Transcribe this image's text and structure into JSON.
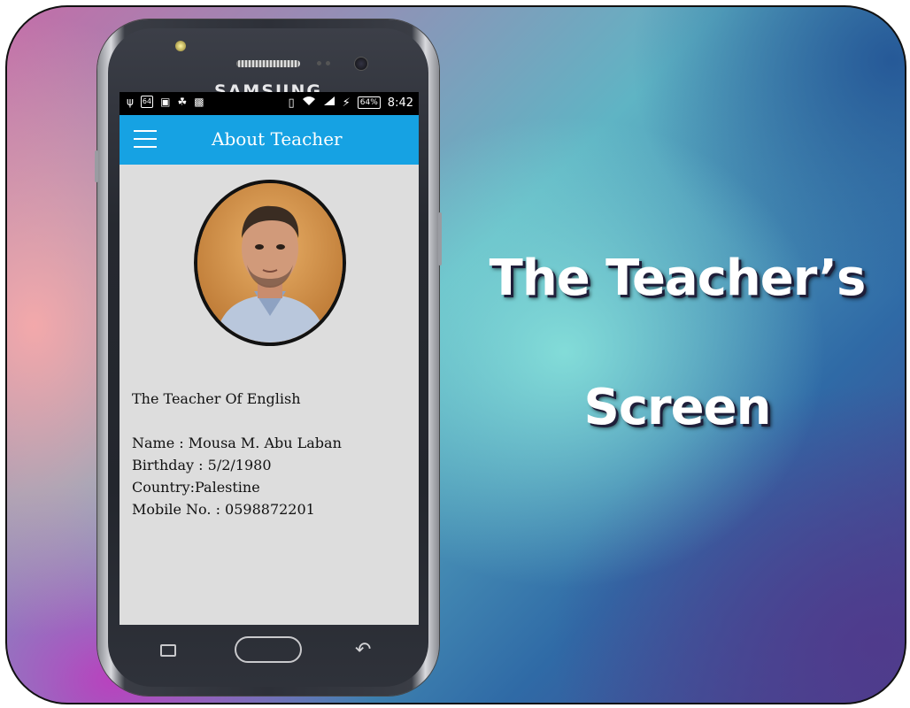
{
  "headline": {
    "line1": "The Teacher’s",
    "line2": "Screen"
  },
  "phone": {
    "brand": "SAMSUNG"
  },
  "status_bar": {
    "left_icons": [
      "usb-icon",
      "badge-64-icon",
      "image-icon",
      "android-icon",
      "photo-icon"
    ],
    "left_badge": "64",
    "battery": "64%",
    "time": "8:42"
  },
  "app_bar": {
    "title": "About Teacher"
  },
  "teacher": {
    "subject": "The Teacher Of English",
    "name": "Name : Mousa M. Abu Laban",
    "birthday": "Birthday : 5/2/1980",
    "country": "Country:Palestine",
    "mobile": "Mobile No. : 0598872201"
  },
  "colors": {
    "app_bar": "#16a2e3",
    "screen_bg": "#dddddd"
  }
}
